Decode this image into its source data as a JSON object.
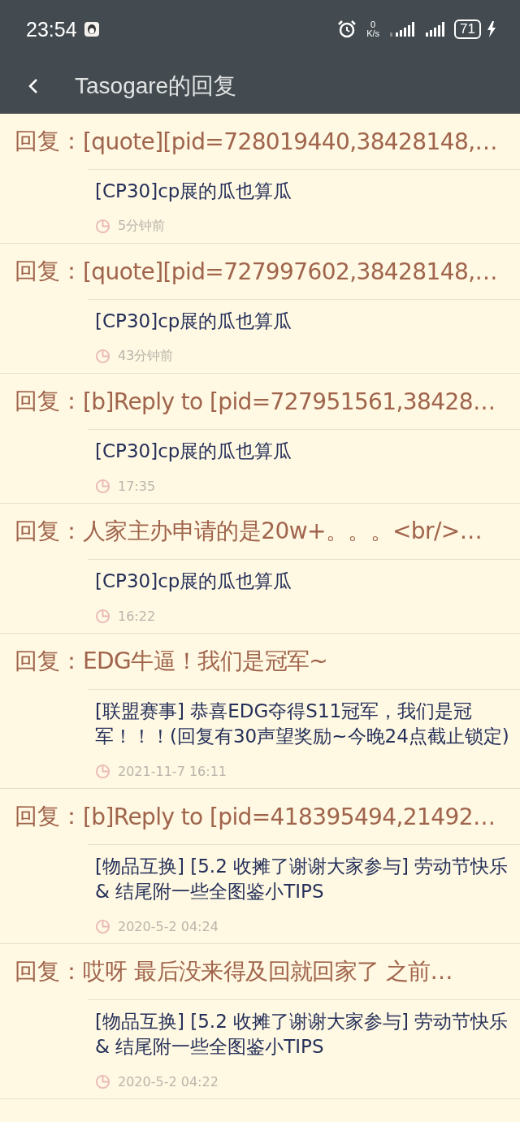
{
  "status_bar": {
    "time": "23:54",
    "net_speed_value": "0",
    "net_speed_unit": "K/s",
    "battery": "71"
  },
  "toolbar": {
    "title": "Tasogare的回复"
  },
  "replies": [
    {
      "prefix": "回复：",
      "text": "[quote][pid=728019440,38428148,…",
      "topic": "[CP30]cp展的瓜也算瓜",
      "time": "5分钟前"
    },
    {
      "prefix": "回复：",
      "text": "[quote][pid=727997602,38428148,…",
      "topic": "[CP30]cp展的瓜也算瓜",
      "time": "43分钟前"
    },
    {
      "prefix": "回复：",
      "text": "[b]Reply to [pid=727951561,38428…",
      "topic": "[CP30]cp展的瓜也算瓜",
      "time": "17:35"
    },
    {
      "prefix": "回复：",
      "text": "人家主办申请的是20w+。。。<br/>…",
      "topic": "[CP30]cp展的瓜也算瓜",
      "time": "16:22"
    },
    {
      "prefix": "回复：",
      "text": "EDG牛逼！我们是冠军~",
      "topic": "[联盟赛事] 恭喜EDG夺得S11冠军，我们是冠军！！！(回复有30声望奖励~今晚24点截止锁定)",
      "time": "2021-11-7 16:11"
    },
    {
      "prefix": "回复：",
      "text": "[b]Reply to [pid=418395494,21492…",
      "topic": "[物品互换] [5.2 收摊了谢谢大家参与] 劳动节快乐 & 结尾附一些全图鉴小TIPS",
      "time": "2020-5-2 04:24"
    },
    {
      "prefix": "回复：",
      "text": "哎呀 最后没来得及回就回家了  之前…",
      "topic": "[物品互换] [5.2 收摊了谢谢大家参与] 劳动节快乐 & 结尾附一些全图鉴小TIPS",
      "time": "2020-5-2 04:22"
    }
  ]
}
